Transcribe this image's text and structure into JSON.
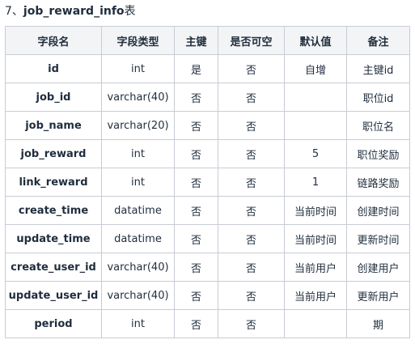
{
  "heading": {
    "prefix": "7、",
    "table_name": "job_reward_info",
    "suffix": "表"
  },
  "columns": [
    "字段名",
    "字段类型",
    "主键",
    "是否可空",
    "默认值",
    "备注"
  ],
  "rows": [
    [
      "id",
      "int",
      "是",
      "否",
      "自增",
      "主键id"
    ],
    [
      "job_id",
      "varchar(40)",
      "否",
      "否",
      "",
      "职位id"
    ],
    [
      "job_name",
      "varchar(20)",
      "否",
      "否",
      "",
      "职位名"
    ],
    [
      "job_reward",
      "int",
      "否",
      "否",
      "5",
      "职位奖励"
    ],
    [
      "link_reward",
      "int",
      "否",
      "否",
      "1",
      "链路奖励"
    ],
    [
      "create_time",
      "datatime",
      "否",
      "否",
      "当前时间",
      "创建时间"
    ],
    [
      "update_time",
      "datatime",
      "否",
      "否",
      "当前时间",
      "更新时间"
    ],
    [
      "create_user_id",
      "varchar(40)",
      "否",
      "否",
      "当前用户",
      "创建用户"
    ],
    [
      "update_user_id",
      "varchar(40)",
      "否",
      "否",
      "当前用户",
      "更新用户"
    ],
    [
      "period",
      "int",
      "否",
      "否",
      "",
      "期"
    ]
  ]
}
